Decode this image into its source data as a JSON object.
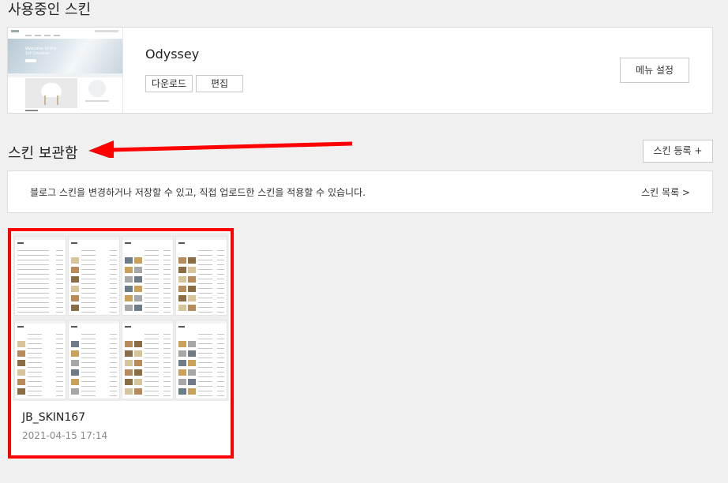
{
  "current_skin": {
    "section_title": "사용중인 스킨",
    "name": "Odyssey",
    "download_label": "다운로드",
    "edit_label": "편집",
    "menu_settings_label": "메뉴 설정",
    "thumbnail_hero_text": "Welcome to the 1st Creative"
  },
  "skin_storage": {
    "section_title": "스킨 보관함",
    "register_label": "스킨 등록 +",
    "info_text": "블로그 스킨을 변경하거나 저장할 수 있고, 직접 업로드한 스킨을 적용할 수 있습니다.",
    "list_link_label": "스킨 목록 >",
    "skins": [
      {
        "name": "JB_SKIN167",
        "date": "2021-04-15 17:14"
      }
    ]
  },
  "colors": {
    "highlight_red": "#ff0000",
    "page_background": "#f0f0f0"
  }
}
